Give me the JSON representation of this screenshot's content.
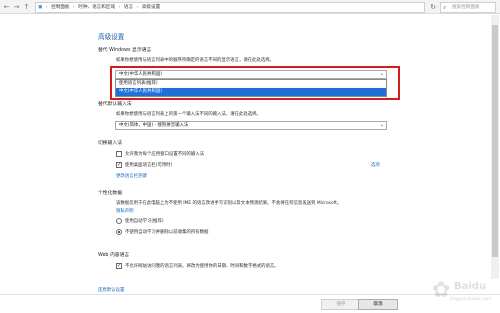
{
  "address_bar": {
    "back_icon": "back-arrow-icon",
    "forward_icon": "forward-arrow-icon",
    "up_icon": "up-arrow-icon",
    "breadcrumb": [
      "控制面板",
      "时钟、语言和区域",
      "语言",
      "高级设置"
    ],
    "search_placeholder": "搜索控制面板"
  },
  "page": {
    "title": "高级设置",
    "display_language": {
      "heading": "替代 Windows 显示语言",
      "description": "如果你想使用与语言列表中的顺序所确定的语言不同的显示语言，请在此处选择。",
      "selected": "中文(中华人民共和国)",
      "options": [
        {
          "label": "使用语言列表(推荐)",
          "selected": false
        },
        {
          "label": "中文(中华人民共和国)",
          "selected": true
        }
      ]
    },
    "default_input": {
      "heading": "替代默认输入法",
      "description": "如果你想使用与语言列表上的第一个输入法不同的输入法，请在此处选择。",
      "selected": "中文(简体，中国) - 搜狗拼音输入法"
    },
    "switch_input": {
      "heading": "切换输入法",
      "per_app_label": "允许我为每个应用窗口设置不同的输入法",
      "per_app_checked": false,
      "langbar_label": "使用桌面语言栏(可用时)",
      "langbar_checked": true,
      "options_link": "选项",
      "hotkeys_link": "更改语言栏热键"
    },
    "personalization": {
      "heading": "个性化数据",
      "description": "该数据仅用于在此电脑上为不使用 IME 的语言改进手写识别以及文本预测结果。不会将任何信息发送到 Microsoft。",
      "privacy_link": "隐私声明",
      "radio1": "使用自动学习(推荐)",
      "radio1_on": false,
      "radio2": "不使用自动学习并删除以前收集的所有数据",
      "radio2_on": true
    },
    "web_language": {
      "heading": "Web 内容语言",
      "checkbox_label": "不允许网站访问我的语言列表。将改为使用你的日期、时间和数字格式的语言。",
      "checked": true
    },
    "restore_link": "还原默认设置"
  },
  "footer": {
    "save_label": "保存",
    "cancel_label": "取消"
  },
  "watermark": {
    "line1": "Baidu",
    "line2": "jingyan.baidu.com"
  }
}
